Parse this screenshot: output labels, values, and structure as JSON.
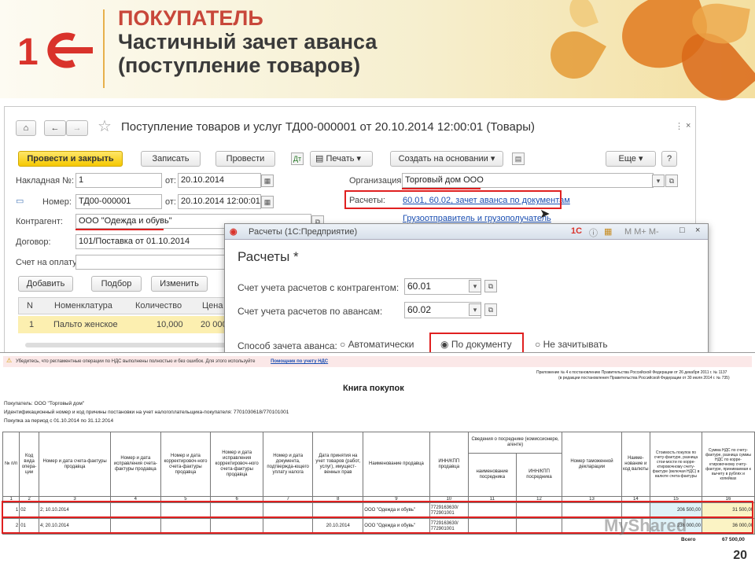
{
  "slide": {
    "title_line1": "ПОКУПАТЕЛЬ",
    "title_line2": "Частичный зачет аванса",
    "title_line3": "(поступление товаров)",
    "page_number": "20",
    "watermark": "MyShared",
    "colors": {
      "title_red": "#c8473a",
      "logo_red": "#d9332b",
      "accent_yellow": "#f5c800",
      "link_blue": "#1b4fb3",
      "highlight_red": "#e02020"
    }
  },
  "doc_window": {
    "title": "Поступление товаров и услуг ТД00-000001 от 20.10.2014 12:00:01 (Товары)",
    "toolbar": {
      "post_close": "Провести и закрыть",
      "save": "Записать",
      "post": "Провести",
      "print": "Печать",
      "create_based": "Создать на основании",
      "more": "Еще",
      "help": "?"
    },
    "fields": {
      "invoice_label": "Накладная №:",
      "invoice_value": "1",
      "from_label": "от:",
      "invoice_date": "20.10.2014",
      "number_label": "Номер:",
      "number_value": "ТД00-000001",
      "number_date": "20.10.2014 12:00:01",
      "org_label": "Организация:",
      "org_value": "Торговый дом ООО",
      "settlements_label": "Расчеты:",
      "settlements_link": "60.01, 60.02, зачет аванса по документам",
      "shipper_link": "Грузоотправитель и грузополучатель",
      "counterparty_label": "Контрагент:",
      "counterparty_value": "ООО \"Одежда и обувь\"",
      "contract_label": "Договор:",
      "contract_value": "101/Поставка от 01.10.2014",
      "payment_label": "Счет на оплату:"
    },
    "table_buttons": {
      "add": "Добавить",
      "select": "Подбор",
      "change": "Изменить"
    },
    "table": {
      "headers": [
        "N",
        "Номенклатура",
        "Количество",
        "Цена"
      ],
      "rows": [
        [
          "1",
          "Пальто женское",
          "10,000",
          "20 000"
        ]
      ]
    }
  },
  "dialog": {
    "title": "Расчеты (1С:Предприятие)",
    "heading": "Расчеты",
    "modified_mark": "*",
    "acc_label": "Счет учета расчетов с контрагентом:",
    "acc_value": "60.01",
    "adv_label": "Счет учета расчетов по авансам:",
    "adv_value": "60.02",
    "method_label": "Способ зачета аванса:",
    "options": [
      {
        "label": "Автоматически",
        "selected": false
      },
      {
        "label": "По документу",
        "selected": true
      },
      {
        "label": "Не зачитывать",
        "selected": false
      }
    ],
    "win_controls": "M M+ M-"
  },
  "report": {
    "warning": "Убедитесь, что регламентные операции по НДС выполнены полностью и без ошибок. Для этого используйте",
    "warning_link": "Помощник по учету НДС",
    "appendix_line1": "Приложение № 4 к постановлению Правительства Российской Федерации от 26 декабря 2011 г. № 1137",
    "appendix_line2": "(в редакции постановления Правительства Российской Федерации от 30 июля 2014 г. № 735)",
    "title": "Книга покупок",
    "buyer": "Покупатель: ООО \"Торговый дом\"",
    "inn_line": "Идентификационный номер и код причины постановки на учет налогоплательщика-покупателя: 7701030618/770101001",
    "period": "Покупка за период с 01.10.2014 по 31.12.2014",
    "headers": [
      "№ п/п",
      "Код вида опера-ции",
      "Номер и дата счета-фактуры продавца",
      "Номер и дата исправления счета-фактуры продавца",
      "Номер и дата корректировоч-ного счета-фактуры продавца",
      "Номер и дата исправления корректировоч-ного счета-фактуры продавца",
      "Номер и дата документа, подтвержда-ющего уплату налога",
      "Дата принятия на учет товаров (работ, услуг), имущест-венных прав",
      "Наименование продавца",
      "ИНН/КПП продавца",
      "Сведения о посреднике (комиссионере, агенте)",
      "Номер таможенной декларации",
      "Наиме-нование и код валюты",
      "Стоимость покупок по счету-фактуре, разница стои-мости по корре-ктировочному счету-фактуре (включая НДС) в валюте счета-фактуры",
      "Сумма НДС по счету-фактуре, разница суммы НДС по корре-ктировочному счету-фактуре, принимаемая к вычету в рублях и копейках"
    ],
    "sub_headers": [
      "наименование посредника",
      "ИНН/КПП посредника"
    ],
    "col_numbers": [
      "1",
      "2",
      "3",
      "4",
      "5",
      "6",
      "7",
      "8",
      "9",
      "10",
      "11",
      "12",
      "13",
      "14",
      "15",
      "16"
    ],
    "rows": [
      {
        "n": "1",
        "code": "02",
        "doc": "2; 10.10.2014",
        "accepted": "",
        "seller": "ООО \"Одежда и обувь\"",
        "inn": "7729163630/ 772901001",
        "cost": "206 500,00",
        "vat": "31 500,00"
      },
      {
        "n": "2",
        "code": "01",
        "doc": "4; 20.10.2014",
        "accepted": "20.10.2014",
        "seller": "ООО \"Одежда и обувь\"",
        "inn": "7729163630/ 772901001",
        "cost": "236 000,00",
        "vat": "36 000,00"
      }
    ],
    "total_label": "Всего",
    "total_vat": "67 500,00"
  }
}
